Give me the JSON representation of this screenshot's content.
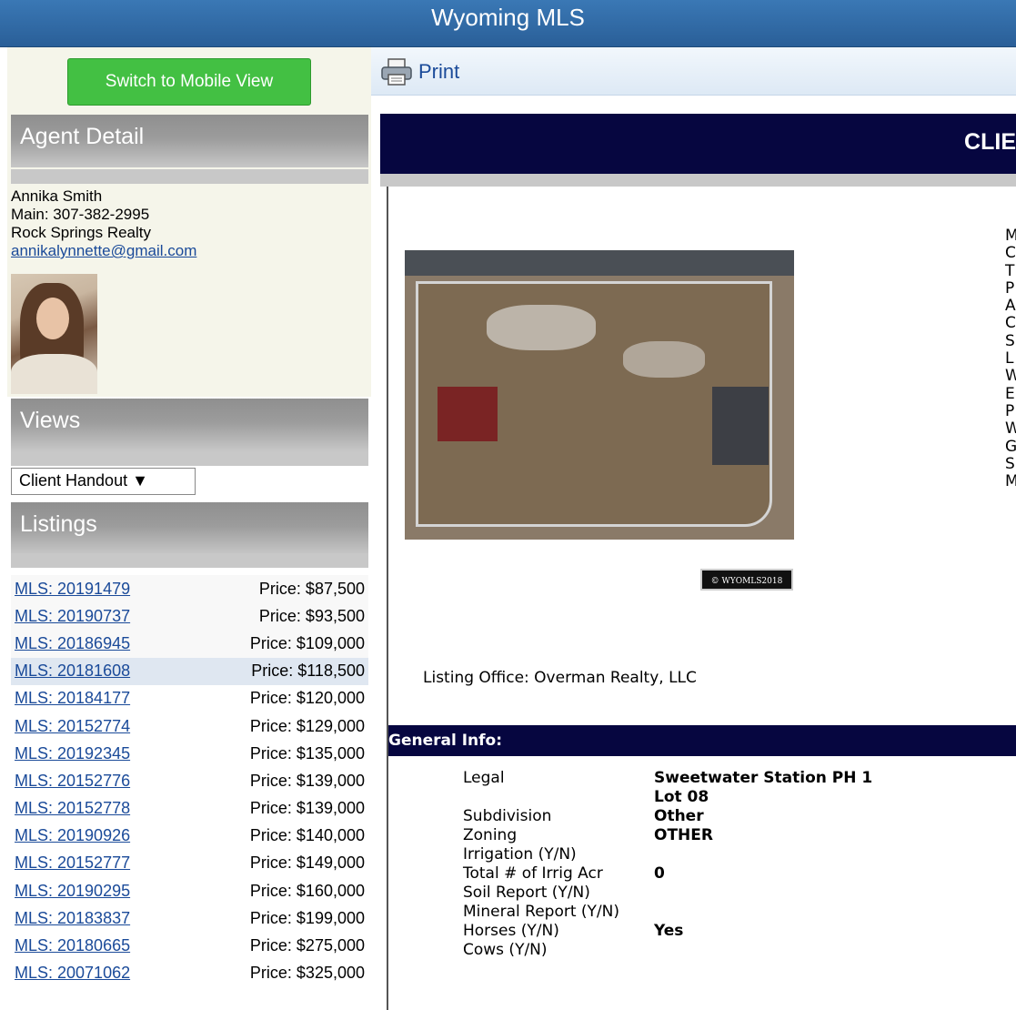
{
  "header": {
    "title": "Wyoming MLS"
  },
  "sidebar": {
    "mobile_button": "Switch to Mobile View",
    "agent_detail": {
      "heading": "Agent Detail",
      "name": "Annika Smith",
      "phone": "Main: 307-382-2995",
      "office": "Rock Springs Realty",
      "email": "annikalynnette@gmail.com"
    },
    "views": {
      "heading": "Views",
      "selected": "Client Handout ▼"
    },
    "listings": {
      "heading": "Listings",
      "items": [
        {
          "mls": "MLS: 20191479",
          "price": "Price: $87,500"
        },
        {
          "mls": "MLS: 20190737",
          "price": "Price: $93,500"
        },
        {
          "mls": "MLS: 20186945",
          "price": "Price: $109,000"
        },
        {
          "mls": "MLS: 20181608",
          "price": "Price: $118,500"
        },
        {
          "mls": "MLS: 20184177",
          "price": "Price: $120,000"
        },
        {
          "mls": "MLS: 20152774",
          "price": "Price: $129,000"
        },
        {
          "mls": "MLS: 20192345",
          "price": "Price: $135,000"
        },
        {
          "mls": "MLS: 20152776",
          "price": "Price: $139,000"
        },
        {
          "mls": "MLS: 20152778",
          "price": "Price: $139,000"
        },
        {
          "mls": "MLS: 20190926",
          "price": "Price: $140,000"
        },
        {
          "mls": "MLS: 20152777",
          "price": "Price: $149,000"
        },
        {
          "mls": "MLS: 20190295",
          "price": "Price: $160,000"
        },
        {
          "mls": "MLS: 20183837",
          "price": "Price: $199,000"
        },
        {
          "mls": "MLS: 20180665",
          "price": "Price: $275,000"
        },
        {
          "mls": "MLS: 20071062",
          "price": "Price: $325,000"
        }
      ]
    }
  },
  "toolbar": {
    "print_label": "Print"
  },
  "report": {
    "header_text": "CLIE",
    "watermark": "© WYOMLS2018",
    "side_letters": [
      "M",
      "C",
      "T",
      "P",
      "A",
      "C",
      "S",
      "L",
      "W",
      "E",
      "P",
      "W",
      "G",
      "S",
      "M"
    ],
    "listing_office": "Listing Office: Overman Realty, LLC",
    "general_info": {
      "heading": "General Info:",
      "rows": [
        {
          "key": "Legal",
          "value": "Sweetwater Station PH 1 Lot 08"
        },
        {
          "key": "Subdivision",
          "value": "Other"
        },
        {
          "key": "Zoning",
          "value": "OTHER"
        },
        {
          "key": "Irrigation (Y/N)",
          "value": ""
        },
        {
          "key": "Total # of Irrig Acr",
          "value": "0"
        },
        {
          "key": "Soil Report (Y/N)",
          "value": ""
        },
        {
          "key": "Mineral Report (Y/N)",
          "value": ""
        },
        {
          "key": "Horses (Y/N)",
          "value": "Yes"
        },
        {
          "key": "Cows (Y/N)",
          "value": ""
        }
      ]
    }
  },
  "colors": {
    "header_blue": "#2a5f98",
    "navy": "#060640",
    "mobile_green": "#43c043",
    "link": "#1a4a99"
  },
  "icons": {
    "print": "printer-icon"
  }
}
